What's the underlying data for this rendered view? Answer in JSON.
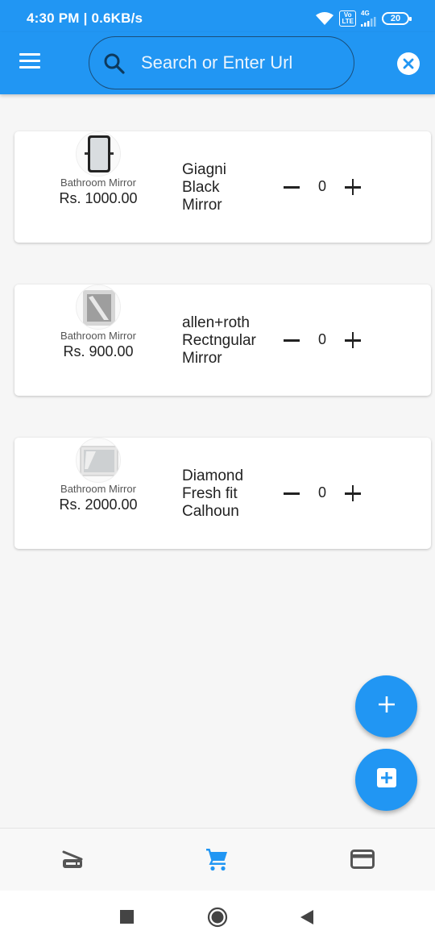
{
  "status_bar": {
    "time": "4:30 PM | 0.6KB/s",
    "network": "4G",
    "volte": "Vo\nLTE",
    "battery": "20",
    "icons": [
      "wifi-icon",
      "volte-icon",
      "signal-icon",
      "battery-icon"
    ]
  },
  "app_bar": {
    "menu_icon": "hamburger-menu-icon",
    "search_placeholder": "Search or Enter Url",
    "search_value": "",
    "clear_icon": "close-circle-icon"
  },
  "products": [
    {
      "category": "Bathroom Mirror",
      "price": "Rs. 1000.00",
      "name_lines": [
        "Giagni",
        "Black",
        "Mirror"
      ],
      "quantity": "0",
      "thumb": "black-framed-mirror"
    },
    {
      "category": "Bathroom Mirror",
      "price": "Rs. 900.00",
      "name_lines": [
        "allen+roth",
        "Rectngular",
        "Mirror"
      ],
      "quantity": "0",
      "thumb": "silver-framed-mirror"
    },
    {
      "category": "Bathroom Mirror",
      "price": "Rs. 2000.00",
      "name_lines": [
        "Diamond",
        "Fresh fit",
        "Calhoun"
      ],
      "quantity": "0",
      "thumb": "frameless-mirror"
    }
  ],
  "fabs": [
    {
      "icon": "plus-icon"
    },
    {
      "icon": "add-box-icon"
    }
  ],
  "bottom_nav": {
    "items": [
      {
        "icon": "scanner-icon",
        "active": false
      },
      {
        "icon": "cart-icon",
        "active": true
      },
      {
        "icon": "credit-card-icon",
        "active": false
      }
    ],
    "active_color": "#2196f3",
    "inactive_color": "#555555"
  },
  "system_nav": {
    "items": [
      "recents-square-icon",
      "home-circle-icon",
      "back-triangle-icon"
    ]
  },
  "colors": {
    "primary": "#2196f3",
    "background": "#f6f6f6"
  }
}
